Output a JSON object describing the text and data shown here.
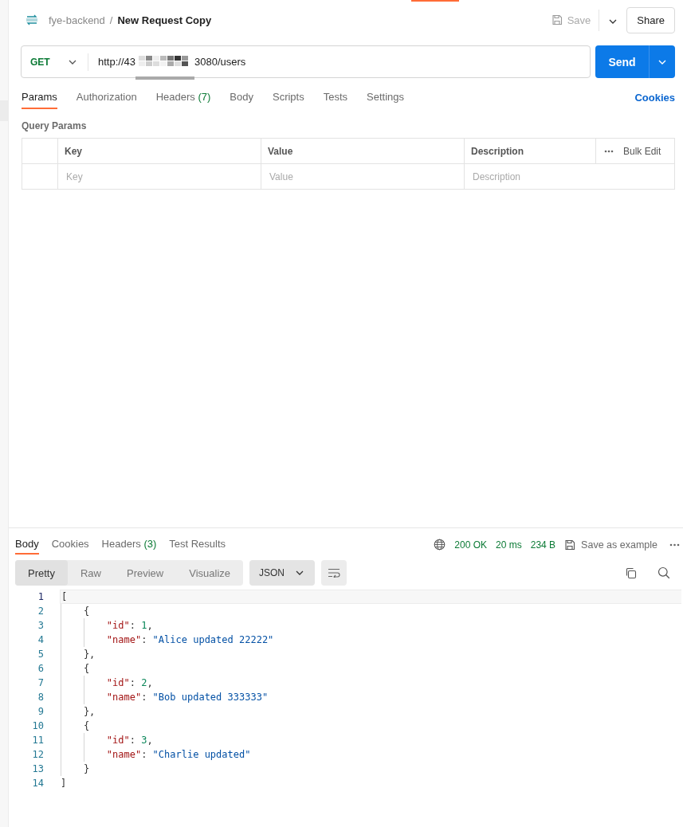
{
  "breadcrumb": {
    "collection": "fye-backend",
    "separator": "/",
    "request": "New Request Copy"
  },
  "header_actions": {
    "save": "Save",
    "share": "Share"
  },
  "request": {
    "method": "GET",
    "url_start": "http://43",
    "url_end": "3080/users",
    "send": "Send"
  },
  "request_tabs": [
    {
      "label": "Params",
      "selected": true
    },
    {
      "label": "Authorization",
      "selected": false
    },
    {
      "label": "Headers",
      "count": "(7)",
      "selected": false
    },
    {
      "label": "Body",
      "selected": false
    },
    {
      "label": "Scripts",
      "selected": false
    },
    {
      "label": "Tests",
      "selected": false
    },
    {
      "label": "Settings",
      "selected": false
    }
  ],
  "cookies_link": "Cookies",
  "query_params": {
    "title": "Query Params",
    "columns": [
      "Key",
      "Value",
      "Description"
    ],
    "bulk_edit": "Bulk Edit",
    "placeholders": [
      "Key",
      "Value",
      "Description"
    ]
  },
  "response_tabs": [
    {
      "label": "Body",
      "selected": true
    },
    {
      "label": "Cookies",
      "selected": false
    },
    {
      "label": "Headers",
      "count": "(3)",
      "selected": false
    },
    {
      "label": "Test Results",
      "selected": false
    }
  ],
  "response_status": {
    "status": "200 OK",
    "time": "20 ms",
    "size": "234 B",
    "save_example": "Save as example"
  },
  "view_modes": [
    {
      "label": "Pretty",
      "selected": true
    },
    {
      "label": "Raw",
      "selected": false
    },
    {
      "label": "Preview",
      "selected": false
    },
    {
      "label": "Visualize",
      "selected": false
    }
  ],
  "format": "JSON",
  "code_lines": [
    {
      "number": "1",
      "tokens": [
        {
          "kind": "punct",
          "text": "["
        }
      ]
    },
    {
      "number": "2",
      "tokens": [
        {
          "kind": "punct",
          "text": "{"
        }
      ]
    },
    {
      "number": "3",
      "tokens": [
        {
          "kind": "key",
          "text": "\"id\""
        },
        {
          "kind": "punct",
          "text": ": "
        },
        {
          "kind": "number",
          "text": "1"
        },
        {
          "kind": "punct",
          "text": ","
        }
      ]
    },
    {
      "number": "4",
      "tokens": [
        {
          "kind": "key",
          "text": "\"name\""
        },
        {
          "kind": "punct",
          "text": ": "
        },
        {
          "kind": "string",
          "text": "\"Alice updated 22222\""
        }
      ]
    },
    {
      "number": "5",
      "tokens": [
        {
          "kind": "punct",
          "text": "},"
        }
      ]
    },
    {
      "number": "6",
      "tokens": [
        {
          "kind": "punct",
          "text": "{"
        }
      ]
    },
    {
      "number": "7",
      "tokens": [
        {
          "kind": "key",
          "text": "\"id\""
        },
        {
          "kind": "punct",
          "text": ": "
        },
        {
          "kind": "number",
          "text": "2"
        },
        {
          "kind": "punct",
          "text": ","
        }
      ]
    },
    {
      "number": "8",
      "tokens": [
        {
          "kind": "key",
          "text": "\"name\""
        },
        {
          "kind": "punct",
          "text": ": "
        },
        {
          "kind": "string",
          "text": "\"Bob updated 333333\""
        }
      ]
    },
    {
      "number": "9",
      "tokens": [
        {
          "kind": "punct",
          "text": "},"
        }
      ]
    },
    {
      "number": "10",
      "tokens": [
        {
          "kind": "punct",
          "text": "{"
        }
      ]
    },
    {
      "number": "11",
      "tokens": [
        {
          "kind": "key",
          "text": "\"id\""
        },
        {
          "kind": "punct",
          "text": ": "
        },
        {
          "kind": "number",
          "text": "3"
        },
        {
          "kind": "punct",
          "text": ","
        }
      ]
    },
    {
      "number": "12",
      "tokens": [
        {
          "kind": "key",
          "text": "\"name\""
        },
        {
          "kind": "punct",
          "text": ": "
        },
        {
          "kind": "string",
          "text": "\"Charlie updated\""
        }
      ]
    },
    {
      "number": "13",
      "tokens": [
        {
          "kind": "punct",
          "text": "}"
        }
      ]
    },
    {
      "number": "14",
      "tokens": [
        {
          "kind": "punct",
          "text": "]"
        }
      ]
    }
  ]
}
